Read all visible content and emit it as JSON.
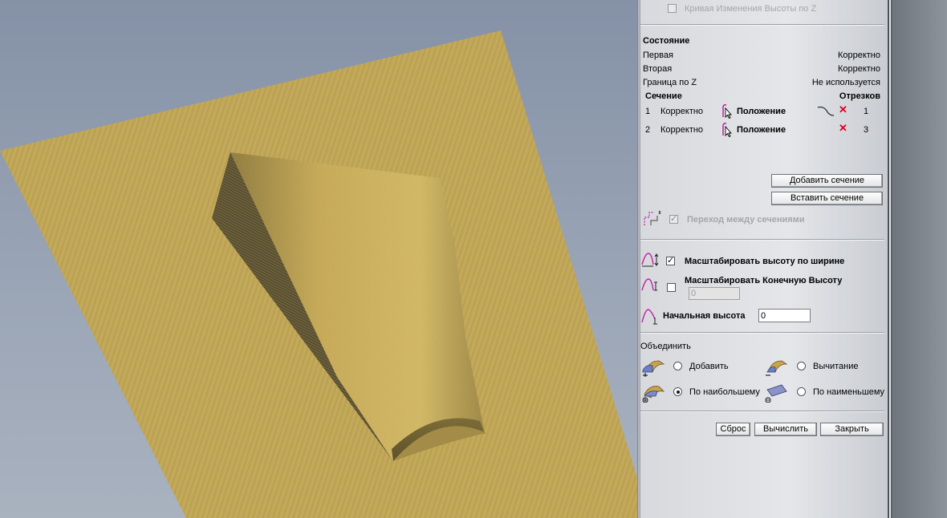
{
  "panel": {
    "z_curve_label": "Кривая Изменения Высоты по Z",
    "z_curve_checked": false,
    "status": {
      "title": "Состояние",
      "rows": [
        {
          "label": "Первая",
          "value": "Корректно"
        },
        {
          "label": "Вторая",
          "value": "Корректно"
        },
        {
          "label": "Граница по Z",
          "value": "Не используется"
        }
      ]
    },
    "sections": {
      "col_section": "Сечение",
      "col_segments": "Отрезков",
      "rows": [
        {
          "num": "1",
          "state": "Корректно",
          "position": "Положение",
          "segments": "1"
        },
        {
          "num": "2",
          "state": "Корректно",
          "position": "Положение",
          "segments": "3"
        }
      ]
    },
    "buttons": {
      "add_section": "Добавить сечение",
      "insert_section": "Вставить сечение",
      "reset": "Сброс",
      "calculate": "Вычислить",
      "close": "Закрыть"
    },
    "transition": {
      "label": "Переход между сечениями",
      "checked": true,
      "disabled": true
    },
    "scale_height": {
      "label": "Масштабировать высоту по ширине",
      "checked": true
    },
    "scale_final": {
      "label": "Масштабировать Конечную Высоту",
      "checked": false,
      "value": "0"
    },
    "start_height": {
      "label": "Начальная высота",
      "value": "0"
    },
    "combine": {
      "title": "Объединить",
      "options": [
        {
          "label": "Добавить",
          "selected": false
        },
        {
          "label": "Вычитание",
          "selected": false
        },
        {
          "label": "По наибольшему",
          "selected": true
        },
        {
          "label": "По наименьшему",
          "selected": false
        }
      ]
    }
  },
  "colors": {
    "background_top": "#8591a6",
    "wood": "#c9ae5c",
    "panel": "#e0e2e5",
    "delete_x": "#e0001b",
    "curve_icon": "#c21fa8"
  }
}
